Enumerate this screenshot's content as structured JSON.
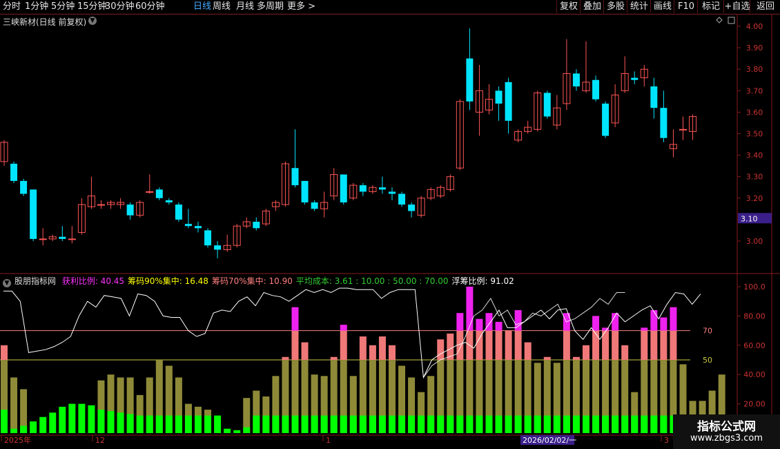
{
  "toolbar": {
    "timeframes": [
      "分时",
      "1分钟",
      "5分钟",
      "15分钟",
      "30分钟",
      "60分钟",
      "日线",
      "周线",
      "月线",
      "多周期",
      "更多"
    ],
    "active_index": 6,
    "right_buttons": [
      "复权",
      "叠加",
      "多股",
      "统计",
      "画线",
      "F10",
      "标记",
      "+自选",
      "返回"
    ]
  },
  "main_chart": {
    "title": "三峡新材(日线 前复权)",
    "price_axis": [
      "4.00",
      "3.90",
      "3.80",
      "3.70",
      "3.60",
      "3.50",
      "3.40",
      "3.30",
      "3.20",
      "3.10",
      "3.00"
    ],
    "current_price": "3.10",
    "candles": [
      {
        "o": 3.37,
        "c": 3.46,
        "h": 3.47,
        "l": 3.35
      },
      {
        "o": 3.36,
        "c": 3.28,
        "h": 3.37,
        "l": 3.27
      },
      {
        "o": 3.28,
        "c": 3.22,
        "h": 3.29,
        "l": 3.21
      },
      {
        "o": 3.24,
        "c": 3.01,
        "h": 3.24,
        "l": 3.0
      },
      {
        "o": 3.01,
        "c": 3.01,
        "h": 3.06,
        "l": 2.98
      },
      {
        "o": 3.01,
        "c": 3.02,
        "h": 3.03,
        "l": 3.0
      },
      {
        "o": 3.02,
        "c": 3.01,
        "h": 3.07,
        "l": 3.0
      },
      {
        "o": 3.01,
        "c": 3.01,
        "h": 3.07,
        "l": 2.99
      },
      {
        "o": 3.04,
        "c": 3.17,
        "h": 3.2,
        "l": 3.03
      },
      {
        "o": 3.16,
        "c": 3.21,
        "h": 3.3,
        "l": 3.15
      },
      {
        "o": 3.17,
        "c": 3.17,
        "h": 3.19,
        "l": 3.15
      },
      {
        "o": 3.17,
        "c": 3.18,
        "h": 3.19,
        "l": 3.15
      },
      {
        "o": 3.17,
        "c": 3.18,
        "h": 3.2,
        "l": 3.15
      },
      {
        "o": 3.17,
        "c": 3.12,
        "h": 3.18,
        "l": 3.1
      },
      {
        "o": 3.12,
        "c": 3.18,
        "h": 3.19,
        "l": 3.11
      },
      {
        "o": 3.23,
        "c": 3.23,
        "h": 3.31,
        "l": 3.22
      },
      {
        "o": 3.24,
        "c": 3.2,
        "h": 3.25,
        "l": 3.19
      },
      {
        "o": 3.19,
        "c": 3.18,
        "h": 3.2,
        "l": 3.17
      },
      {
        "o": 3.17,
        "c": 3.1,
        "h": 3.18,
        "l": 3.09
      },
      {
        "o": 3.08,
        "c": 3.07,
        "h": 3.15,
        "l": 3.06
      },
      {
        "o": 3.07,
        "c": 3.06,
        "h": 3.09,
        "l": 3.04
      },
      {
        "o": 3.05,
        "c": 2.98,
        "h": 3.06,
        "l": 2.97
      },
      {
        "o": 2.98,
        "c": 2.96,
        "h": 3.0,
        "l": 2.92
      },
      {
        "o": 2.96,
        "c": 2.98,
        "h": 3.03,
        "l": 2.95
      },
      {
        "o": 2.98,
        "c": 3.07,
        "h": 3.08,
        "l": 2.97
      },
      {
        "o": 3.07,
        "c": 3.09,
        "h": 3.11,
        "l": 3.06
      },
      {
        "o": 3.09,
        "c": 3.06,
        "h": 3.11,
        "l": 3.05
      },
      {
        "o": 3.08,
        "c": 3.14,
        "h": 3.15,
        "l": 3.07
      },
      {
        "o": 3.16,
        "c": 3.18,
        "h": 3.19,
        "l": 3.14
      },
      {
        "o": 3.17,
        "c": 3.36,
        "h": 3.37,
        "l": 3.16
      },
      {
        "o": 3.34,
        "c": 3.26,
        "h": 3.52,
        "l": 3.25
      },
      {
        "o": 3.28,
        "c": 3.18,
        "h": 3.28,
        "l": 3.17
      },
      {
        "o": 3.18,
        "c": 3.15,
        "h": 3.19,
        "l": 3.14
      },
      {
        "o": 3.15,
        "c": 3.18,
        "h": 3.23,
        "l": 3.11
      },
      {
        "o": 3.21,
        "c": 3.31,
        "h": 3.34,
        "l": 3.19
      },
      {
        "o": 3.31,
        "c": 3.18,
        "h": 3.31,
        "l": 3.17
      },
      {
        "o": 3.2,
        "c": 3.26,
        "h": 3.27,
        "l": 3.19
      },
      {
        "o": 3.26,
        "c": 3.23,
        "h": 3.27,
        "l": 3.21
      },
      {
        "o": 3.23,
        "c": 3.25,
        "h": 3.26,
        "l": 3.22
      },
      {
        "o": 3.25,
        "c": 3.24,
        "h": 3.3,
        "l": 3.22
      },
      {
        "o": 3.23,
        "c": 3.22,
        "h": 3.25,
        "l": 3.19
      },
      {
        "o": 3.22,
        "c": 3.17,
        "h": 3.23,
        "l": 3.16
      },
      {
        "o": 3.17,
        "c": 3.14,
        "h": 3.18,
        "l": 3.11
      },
      {
        "o": 3.12,
        "c": 3.2,
        "h": 3.21,
        "l": 3.11
      },
      {
        "o": 3.2,
        "c": 3.24,
        "h": 3.25,
        "l": 3.19
      },
      {
        "o": 3.21,
        "c": 3.25,
        "h": 3.26,
        "l": 3.2
      },
      {
        "o": 3.24,
        "c": 3.3,
        "h": 3.31,
        "l": 3.23
      },
      {
        "o": 3.34,
        "c": 3.65,
        "h": 3.66,
        "l": 3.33
      },
      {
        "o": 3.85,
        "c": 3.65,
        "h": 3.99,
        "l": 3.61
      },
      {
        "o": 3.6,
        "c": 3.7,
        "h": 3.82,
        "l": 3.49
      },
      {
        "o": 3.61,
        "c": 3.66,
        "h": 3.73,
        "l": 3.59
      },
      {
        "o": 3.7,
        "c": 3.64,
        "h": 3.72,
        "l": 3.56
      },
      {
        "o": 3.74,
        "c": 3.56,
        "h": 3.76,
        "l": 3.5
      },
      {
        "o": 3.47,
        "c": 3.51,
        "h": 3.52,
        "l": 3.46
      },
      {
        "o": 3.51,
        "c": 3.53,
        "h": 3.56,
        "l": 3.5
      },
      {
        "o": 3.52,
        "c": 3.69,
        "h": 3.7,
        "l": 3.51
      },
      {
        "o": 3.69,
        "c": 3.58,
        "h": 3.7,
        "l": 3.57
      },
      {
        "o": 3.54,
        "c": 3.62,
        "h": 3.68,
        "l": 3.52
      },
      {
        "o": 3.64,
        "c": 3.78,
        "h": 3.94,
        "l": 3.61
      },
      {
        "o": 3.78,
        "c": 3.72,
        "h": 3.8,
        "l": 3.7
      },
      {
        "o": 3.7,
        "c": 3.74,
        "h": 3.93,
        "l": 3.69
      },
      {
        "o": 3.75,
        "c": 3.66,
        "h": 3.77,
        "l": 3.65
      },
      {
        "o": 3.64,
        "c": 3.49,
        "h": 3.65,
        "l": 3.48
      },
      {
        "o": 3.55,
        "c": 3.68,
        "h": 3.73,
        "l": 3.53
      },
      {
        "o": 3.7,
        "c": 3.78,
        "h": 3.86,
        "l": 3.69
      },
      {
        "o": 3.76,
        "c": 3.75,
        "h": 3.79,
        "l": 3.73
      },
      {
        "o": 3.76,
        "c": 3.8,
        "h": 3.82,
        "l": 3.72
      },
      {
        "o": 3.72,
        "c": 3.62,
        "h": 3.76,
        "l": 3.57
      },
      {
        "o": 3.62,
        "c": 3.48,
        "h": 3.7,
        "l": 3.46
      },
      {
        "o": 3.43,
        "c": 3.45,
        "h": 3.52,
        "l": 3.39
      },
      {
        "o": 3.52,
        "c": 3.52,
        "h": 3.58,
        "l": 3.47
      },
      {
        "o": 3.51,
        "c": 3.58,
        "h": 3.59,
        "l": 3.47
      }
    ]
  },
  "indicator": {
    "name": "股朋指标网",
    "readouts": [
      {
        "label": "获利比例: ",
        "value": "40.45",
        "color": "#ff33ff"
      },
      {
        "label": "筹码90%集中: ",
        "value": "16.48",
        "color": "#ffff00"
      },
      {
        "label": "筹码70%集中: ",
        "value": "10.90",
        "color": "#ff7f7f"
      },
      {
        "label": "平均成本: ",
        "value": "3.61 : 10.00 : 50.00 : 70.00",
        "color": "#33cc33"
      },
      {
        "label": "浮筹比例: ",
        "value": "91.02",
        "color": "#ffffff"
      }
    ],
    "axis": [
      "100.0",
      "80.00",
      "60.00",
      "40.00",
      "20.00"
    ],
    "line70_label": "70",
    "line50_label": "50",
    "bars": [
      60,
      38,
      30,
      0,
      0,
      0,
      0,
      0,
      0,
      0,
      36,
      40,
      38,
      38,
      26,
      38,
      50,
      46,
      38,
      20,
      18,
      16,
      0,
      0,
      0,
      24,
      29,
      25,
      39,
      52,
      86,
      62,
      40,
      39,
      52,
      74,
      39,
      66,
      60,
      66,
      60,
      46,
      38,
      28,
      39,
      64,
      68,
      82,
      100,
      78,
      82,
      76,
      70,
      84,
      62,
      48,
      52,
      48,
      82,
      52,
      60,
      80,
      72,
      82,
      60,
      28,
      72,
      84,
      79,
      86,
      47,
      22,
      22,
      29,
      40
    ],
    "green_bars": [
      16,
      3,
      5,
      8,
      11,
      14,
      18,
      20,
      20,
      19,
      16,
      15,
      14,
      13,
      12,
      12,
      12,
      12,
      12,
      12,
      12,
      12,
      12,
      3,
      2,
      4,
      12,
      12,
      12,
      12,
      12,
      12,
      12,
      12,
      12,
      12,
      12,
      12,
      12,
      12,
      12,
      12,
      12,
      12,
      12,
      12,
      12,
      12,
      12,
      12,
      12,
      12,
      12,
      12,
      12,
      12,
      12,
      12,
      12,
      12,
      12,
      12,
      12,
      12,
      12,
      12,
      12,
      12,
      12,
      12,
      12,
      12,
      12,
      12,
      12
    ],
    "line": [
      97,
      97,
      90,
      55,
      56,
      57,
      59,
      62,
      66,
      80,
      90,
      86,
      94,
      93,
      92,
      80,
      95,
      94,
      90,
      80,
      79,
      79,
      70,
      66,
      68,
      82,
      84,
      83,
      90,
      93,
      87,
      96,
      94,
      93,
      90,
      94,
      98,
      96,
      98,
      96,
      99,
      99,
      98,
      98,
      98,
      92,
      96,
      98,
      98,
      98,
      38,
      50,
      54,
      57,
      60,
      62,
      58,
      68,
      76,
      84,
      72,
      72,
      76,
      80,
      84,
      78,
      84,
      85,
      70,
      64,
      72,
      64,
      72,
      82,
      76,
      80,
      84,
      87,
      78,
      88,
      96,
      95,
      88,
      95
    ],
    "secondary_line": [
      null,
      null,
      null,
      null,
      null,
      null,
      null,
      null,
      null,
      null,
      null,
      null,
      null,
      null,
      null,
      null,
      null,
      null,
      null,
      null,
      null,
      null,
      null,
      null,
      null,
      null,
      null,
      null,
      null,
      null,
      null,
      null,
      null,
      null,
      null,
      null,
      null,
      null,
      null,
      null,
      null,
      null,
      null,
      null,
      null,
      null,
      null,
      null,
      null,
      null,
      38,
      46,
      50,
      52,
      54,
      66,
      80,
      84,
      92,
      80,
      84,
      74,
      76,
      82,
      80,
      84,
      88,
      76,
      78,
      82,
      86,
      92,
      88,
      96,
      96
    ]
  },
  "date_axis": {
    "labels": [
      "2025年",
      "12",
      "1",
      "3"
    ],
    "cursor_date": "2026/02/02/一"
  },
  "watermark": {
    "title": "指标公式网",
    "url": "www.zbgs3.com"
  },
  "colors": {
    "up": "#ff5555",
    "down": "#00e5ff",
    "grid_red": "#8a1a1a",
    "bar_olive": "#8e8a38",
    "bar_salmon": "#f07878",
    "bar_magenta": "#ee22ee",
    "bar_green": "#00ff00"
  }
}
